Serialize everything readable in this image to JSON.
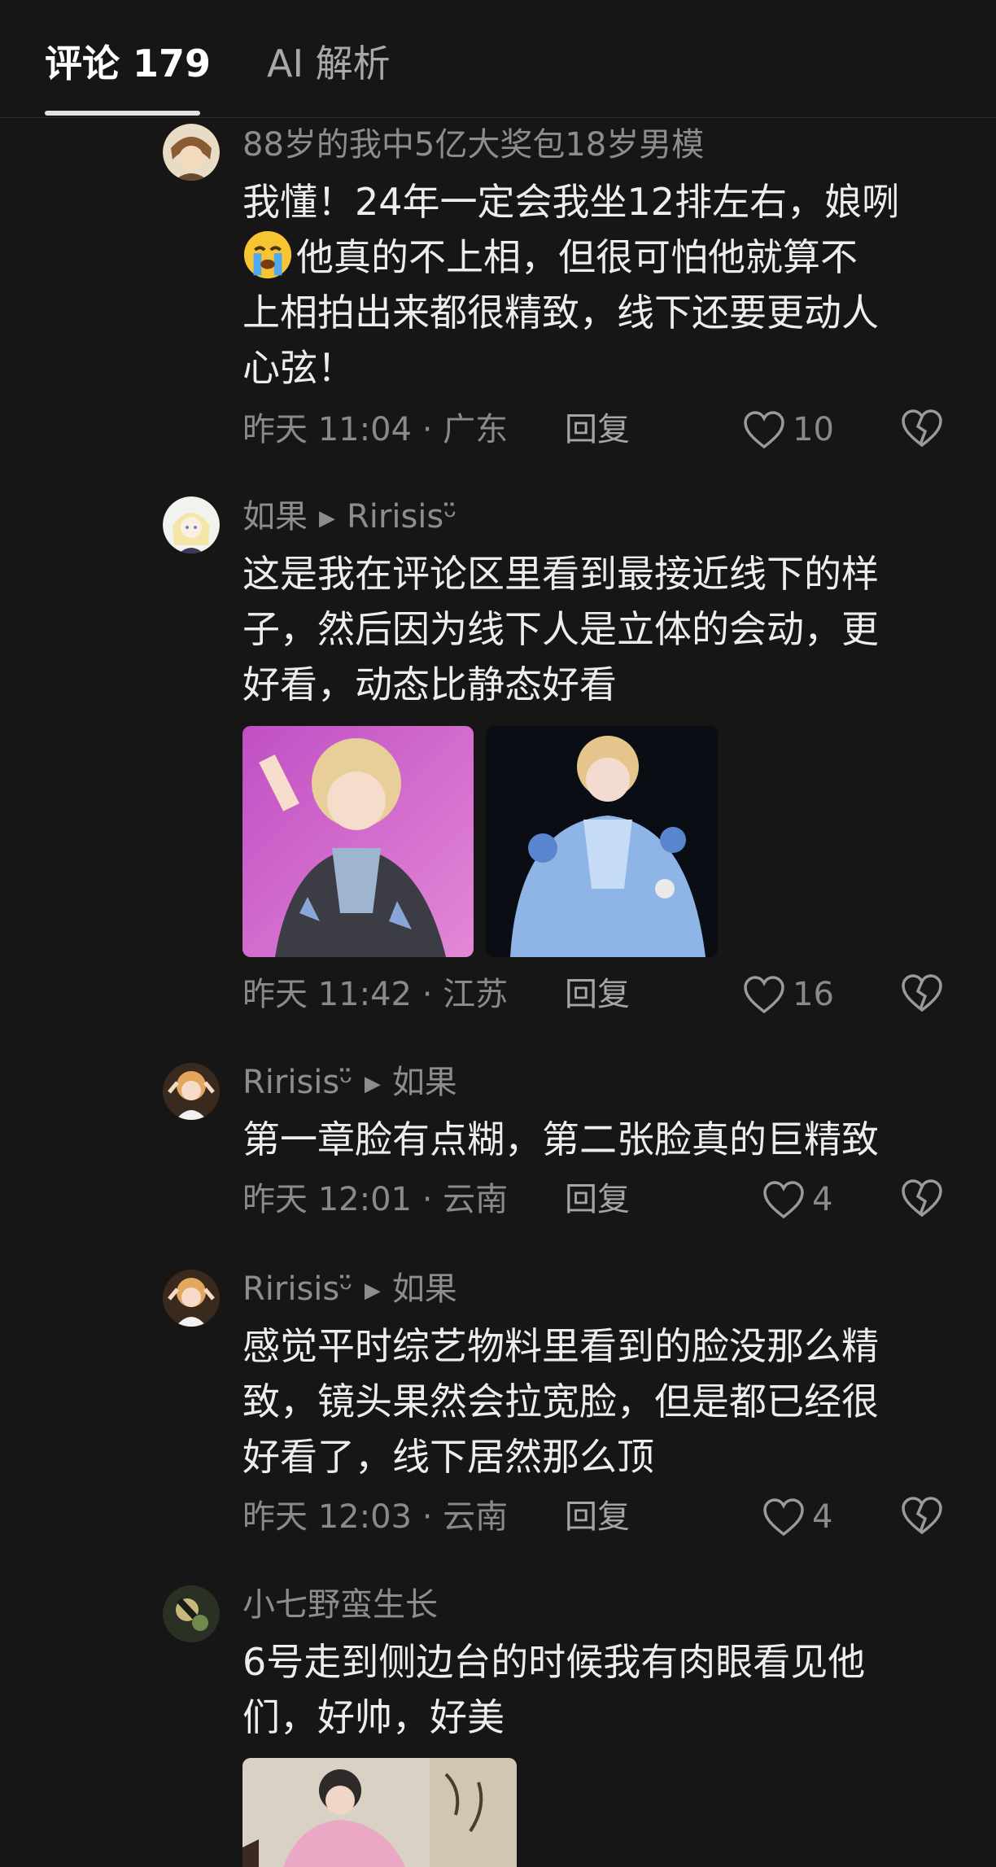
{
  "tabs": {
    "comments_label": "评论 179",
    "ai_label": "AI 解析"
  },
  "comments": [
    {
      "author": "88岁的我中5亿大奖包18岁男模",
      "text_line1": "我懂！24年一定会我坐12排左右，娘咧",
      "text_line2": "他真的不上相，但很可怕他就算不",
      "text_line3": "上相拍出来都很精致，线下还要更动人",
      "text_line4": "心弦！",
      "time_location": "昨天 11:04 · 广东",
      "reply_label": "回复",
      "likes": "10"
    },
    {
      "author": "如果",
      "reply_to": "Ririsisᵕ̈",
      "text_line1": "这是我在评论区里看到最接近线下的样",
      "text_line2": "子，然后因为线下人是立体的会动，更",
      "text_line3": "好看，动态比静态好看",
      "time_location": "昨天 11:42 · 江苏",
      "reply_label": "回复",
      "likes": "16"
    },
    {
      "author": "Ririsisᵕ̈",
      "reply_to": "如果",
      "text_line1": "第一章脸有点糊，第二张脸真的巨精致",
      "time_location": "昨天 12:01 · 云南",
      "reply_label": "回复",
      "likes": "4"
    },
    {
      "author": "Ririsisᵕ̈",
      "reply_to": "如果",
      "text_line1": "感觉平时综艺物料里看到的脸没那么精",
      "text_line2": "致，镜头果然会拉宽脸，但是都已经很",
      "text_line3": "好看了，线下居然那么顶",
      "time_location": "昨天 12:03 · 云南",
      "reply_label": "回复",
      "likes": "4"
    },
    {
      "author": "小七野蛮生长",
      "text_line1": "6号走到侧边台的时候我有肉眼看见他",
      "text_line2": "们，好帅，好美"
    }
  ],
  "icons": {
    "heart": "heart-outline-icon",
    "dislike": "broken-heart-icon",
    "reply_arrow": "play-triangle-icon",
    "emoji": "crying-face-emoji"
  },
  "colors": {
    "background": "#161616",
    "text": "#ededed",
    "meta": "#8a8a8a"
  }
}
